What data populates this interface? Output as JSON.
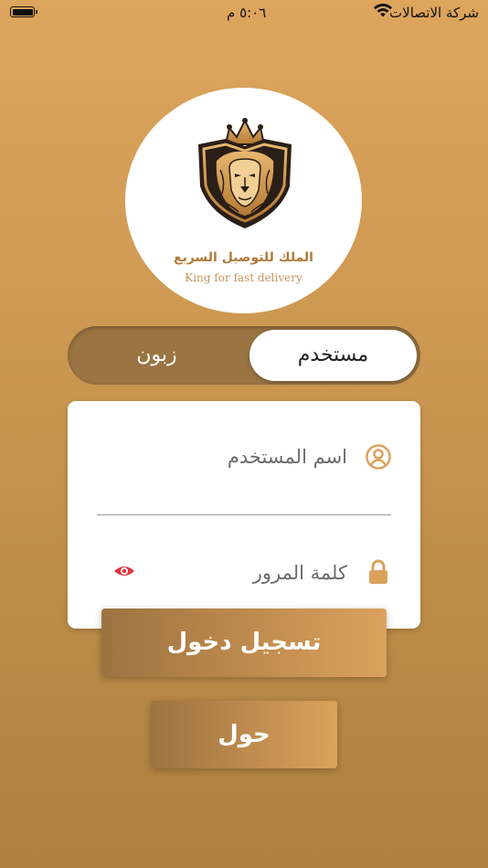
{
  "status_bar": {
    "carrier": "شركة الاتصالات",
    "time": "٥:٠٦ م"
  },
  "logo": {
    "arabic_name": "الملك للتوصيل السريع",
    "english_name": "King for fast delivery"
  },
  "toggle": {
    "user_label": "مستخدم",
    "customer_label": "زبون",
    "selected": "user"
  },
  "form": {
    "username_placeholder": "اسم المستخدم",
    "username_value": "",
    "password_placeholder": "كلمة المرور",
    "password_value": ""
  },
  "buttons": {
    "login_label": "تسجيل دخول",
    "about_label": "حول"
  },
  "colors": {
    "accent": "#dba25d",
    "eye_icon": "#e0343f",
    "field_icon": "#dba25d"
  }
}
